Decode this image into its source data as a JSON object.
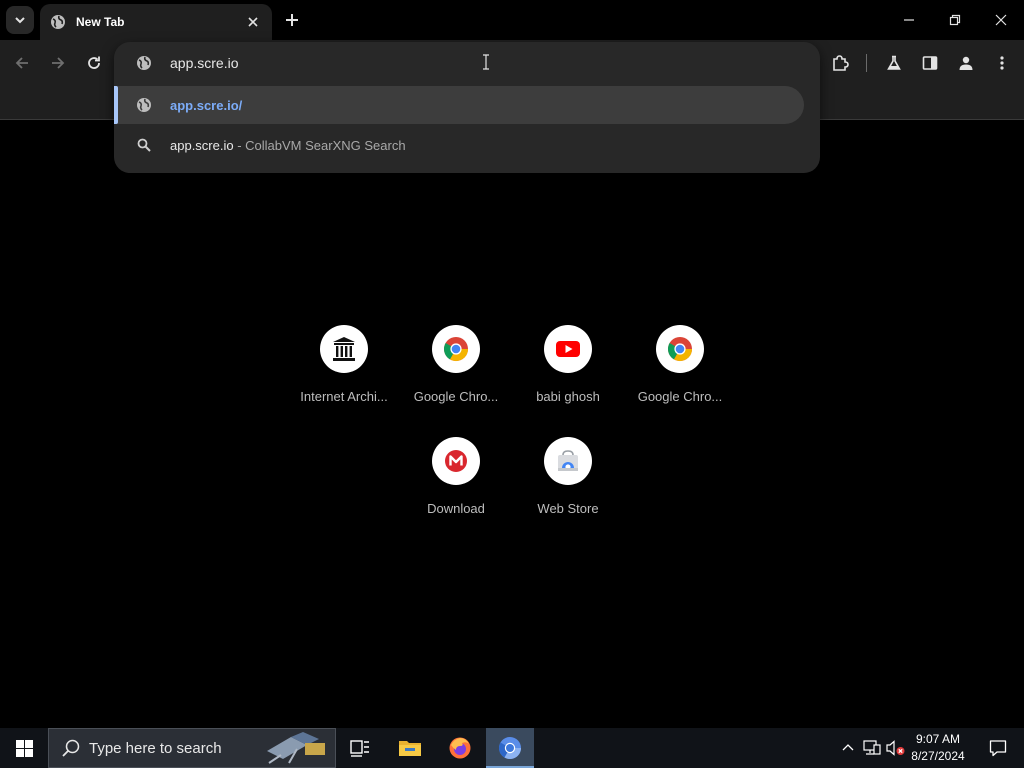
{
  "browser": {
    "active_tab": {
      "title": "New Tab"
    },
    "omnibox": {
      "input_value": "app.scre.io",
      "suggestions": [
        {
          "text": "app.scre.io/",
          "description": "",
          "icon": "globe-icon",
          "selected": true
        },
        {
          "text": "app.scre.io",
          "description": " - CollabVM SearXNG Search",
          "icon": "search-icon",
          "selected": false
        }
      ]
    }
  },
  "new_tab_page": {
    "shortcuts": [
      {
        "label": "Internet Archi...",
        "icon": "internet-archive-icon"
      },
      {
        "label": "Google Chro...",
        "icon": "chrome-icon"
      },
      {
        "label": "babi ghosh",
        "icon": "youtube-icon"
      },
      {
        "label": "Google Chro...",
        "icon": "chrome-icon"
      },
      {
        "label": "Download",
        "icon": "mega-icon"
      },
      {
        "label": "Web Store",
        "icon": "web-store-icon"
      }
    ]
  },
  "taskbar": {
    "search_placeholder": "Type here to search",
    "clock": {
      "time": "9:07 AM",
      "date": "8/27/2024"
    },
    "apps": [
      "task-view-icon",
      "file-explorer-icon",
      "firefox-icon",
      "chromium-icon"
    ]
  },
  "colors": {
    "suggestion_link": "#7cacf8",
    "selection_bar": "#a8c7fa",
    "youtube_red": "#ff0000",
    "mega_red": "#d9272e"
  }
}
